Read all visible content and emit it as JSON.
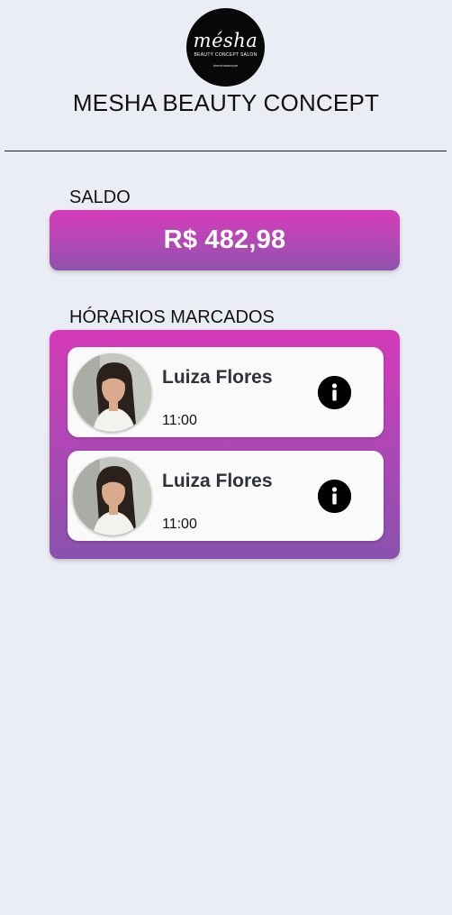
{
  "brand": {
    "logo_word": "mésha",
    "logo_subtitle": "BEAUTY CONCEPT SALON",
    "logo_tagline": "#meshasempre",
    "title": "MESHA BEAUTY CONCEPT"
  },
  "balance": {
    "label": "SALDO",
    "value": "R$ 482,98"
  },
  "appointments": {
    "label": "HÓRARIOS MARCADOS",
    "items": [
      {
        "name": "Luiza Flores",
        "time": "11:00",
        "avatar_icon": "profile-photo",
        "action_icon": "info-icon"
      },
      {
        "name": "Luiza Flores",
        "time": "11:00",
        "avatar_icon": "profile-photo",
        "action_icon": "info-icon"
      }
    ]
  },
  "colors": {
    "background": "#eaedf4",
    "gradient_top": "#d63ab8",
    "gradient_bottom": "#8952ad",
    "card": "#fafafa"
  }
}
